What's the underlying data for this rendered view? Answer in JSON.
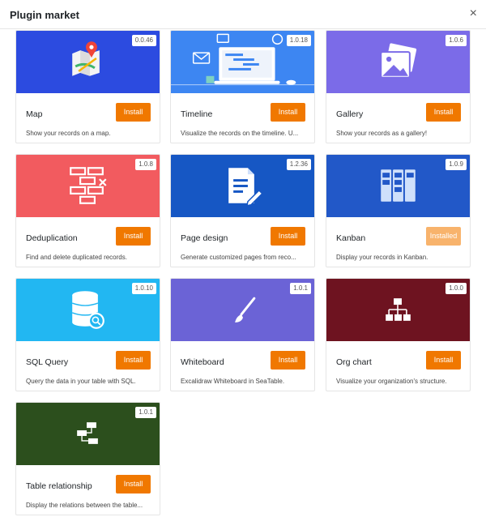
{
  "window": {
    "title": "Plugin market",
    "close_glyph": "×"
  },
  "plugins": [
    {
      "name": "Map",
      "version": "0.0.46",
      "button": "Install",
      "description": "Show your records on a map.",
      "color": "#2c4be0",
      "icon": "map-icon"
    },
    {
      "name": "Timeline",
      "version": "1.0.18",
      "button": "Install",
      "description": "Visualize the records on the timeline. U...",
      "color": "#3d86f2",
      "icon": "timeline-icon"
    },
    {
      "name": "Gallery",
      "version": "1.0.6",
      "button": "Install",
      "description": "Show your records as a gallery!",
      "color": "#7b6be8",
      "icon": "gallery-icon"
    },
    {
      "name": "Deduplication",
      "version": "1.0.8",
      "button": "Install",
      "description": "Find and delete duplicated records.",
      "color": "#f25b5f",
      "icon": "deduplication-icon"
    },
    {
      "name": "Page design",
      "version": "1.2.36",
      "button": "Install",
      "description": "Generate customized pages from reco...",
      "color": "#1657c4",
      "icon": "page-design-icon"
    },
    {
      "name": "Kanban",
      "version": "1.0.9",
      "button": "Installed",
      "description": "Display your records in Kanban.",
      "color": "#2258c8",
      "icon": "kanban-icon"
    },
    {
      "name": "SQL Query",
      "version": "1.0.10",
      "button": "Install",
      "description": "Query the data in your table with SQL.",
      "color": "#22b7f2",
      "icon": "sql-query-icon"
    },
    {
      "name": "Whiteboard",
      "version": "1.0.1",
      "button": "Install",
      "description": "Excalidraw Whiteboard in SeaTable.",
      "color": "#6b63d6",
      "icon": "whiteboard-icon"
    },
    {
      "name": "Org chart",
      "version": "1.0.0",
      "button": "Install",
      "description": "Visualize your organization's structure.",
      "color": "#6e1320",
      "icon": "org-chart-icon"
    },
    {
      "name": "Table relationship",
      "version": "1.0.1",
      "button": "Install",
      "description": "Display the relations between the table...",
      "color": "#2c4f1d",
      "icon": "table-relationship-icon"
    }
  ]
}
